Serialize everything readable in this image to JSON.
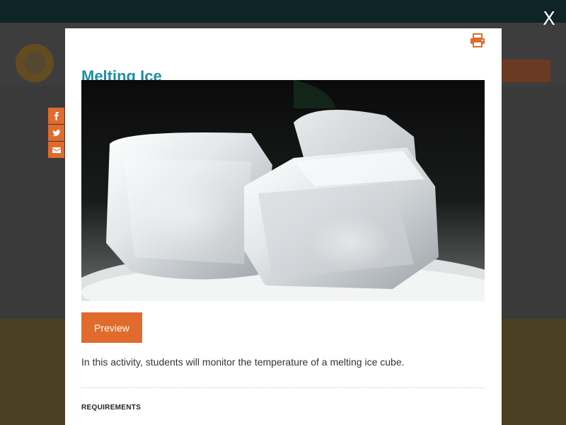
{
  "modal": {
    "title": "Melting Ice",
    "image_alt": "ice cubes",
    "preview_label": "Preview",
    "description": "In this activity, students will monitor the temperature of a melting ice cube.",
    "requirements_heading": "REQUIREMENTS"
  },
  "close_label": "X",
  "share_buttons": [
    "facebook-icon",
    "twitter-icon",
    "envelope-icon"
  ],
  "colors": {
    "accent": "#e06b2c",
    "title": "#1f8ea6",
    "overlay_bg": "#3a3a3a"
  }
}
